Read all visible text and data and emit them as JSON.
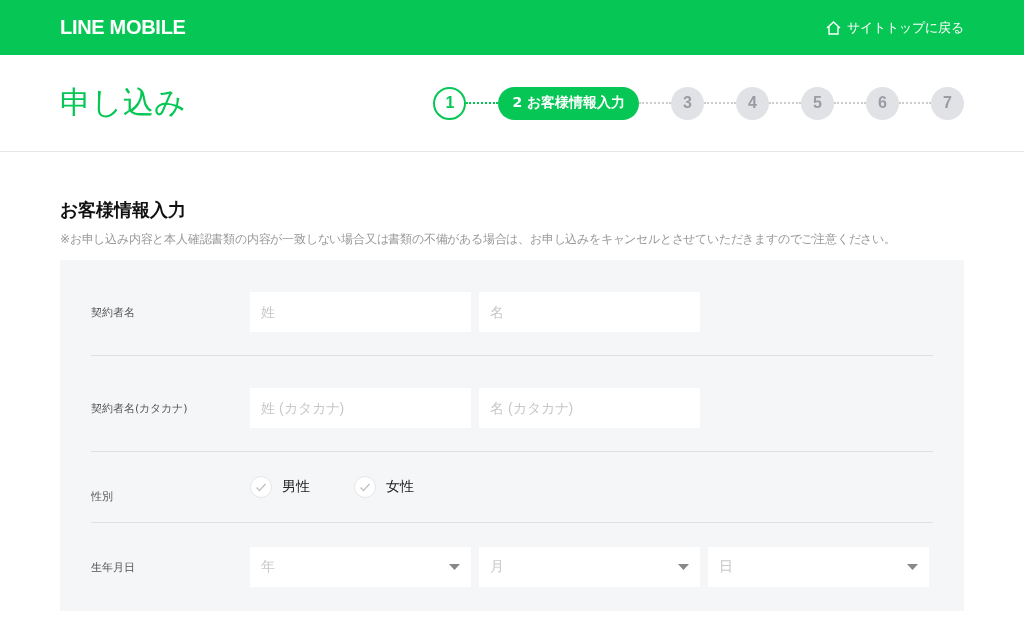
{
  "header": {
    "logo": "LINE MOBILE",
    "top_link": "サイトトップに戻る"
  },
  "page_title": "申し込み",
  "steps": [
    {
      "label": "1",
      "done": true,
      "selected": false
    },
    {
      "label": "2 お客様情報入力",
      "done": false,
      "selected": true
    },
    {
      "label": "3",
      "done": false,
      "selected": false
    },
    {
      "label": "4",
      "done": false,
      "selected": false
    },
    {
      "label": "5",
      "done": false,
      "selected": false
    },
    {
      "label": "6",
      "done": false,
      "selected": false
    },
    {
      "label": "7",
      "done": false,
      "selected": false
    }
  ],
  "section": {
    "title": "お客様情報入力",
    "note": "※お申し込み内容と本人確認書類の内容が一致しない場合又は書類の不備がある場合は、お申し込みをキャンセルとさせていただきますのでご注意ください。"
  },
  "form_rows": [
    {
      "kind": "text",
      "label": "契約者名",
      "fields": [
        {
          "placeholder": "姓"
        },
        {
          "placeholder": "名"
        }
      ]
    },
    {
      "kind": "text",
      "label": "契約者名(カタカナ)",
      "fields": [
        {
          "placeholder": "姓 (カタカナ)"
        },
        {
          "placeholder": "名 (カタカナ)"
        }
      ]
    },
    {
      "kind": "radio",
      "label": "性別",
      "options": [
        {
          "label": "男性",
          "selected": false
        },
        {
          "label": "女性",
          "selected": false
        }
      ]
    },
    {
      "kind": "select",
      "label": "生年月日",
      "fields": [
        {
          "placeholder": "年"
        },
        {
          "placeholder": "月"
        },
        {
          "placeholder": "日"
        }
      ]
    }
  ]
}
